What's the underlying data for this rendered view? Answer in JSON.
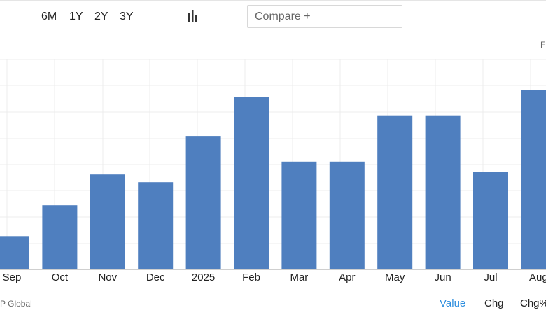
{
  "toolbar": {
    "ranges": [
      "6M",
      "1Y",
      "2Y",
      "3Y"
    ],
    "chart_type_icon": "bar-chart-icon",
    "compare_placeholder": "Compare +"
  },
  "corner_label": "F",
  "footer": {
    "source": "P Global",
    "tabs": [
      "Value",
      "Chg",
      "Chg%"
    ],
    "active_tab": "Value"
  },
  "colors": {
    "bar": "#4f7fbf",
    "grid": "#ececec",
    "active_tab": "#2d8ede"
  },
  "chart_data": {
    "type": "bar",
    "categories": [
      "Sep",
      "Oct",
      "Nov",
      "Dec",
      "2025",
      "Feb",
      "Mar",
      "Apr",
      "May",
      "Jun",
      "Jul",
      "Aug"
    ],
    "values": [
      1.3,
      2.5,
      3.7,
      3.4,
      5.2,
      6.7,
      4.2,
      4.2,
      6.0,
      6.0,
      3.8,
      7.0
    ],
    "ylim": [
      0,
      7.3
    ],
    "grid": true,
    "title": "",
    "xlabel": "",
    "ylabel": ""
  }
}
